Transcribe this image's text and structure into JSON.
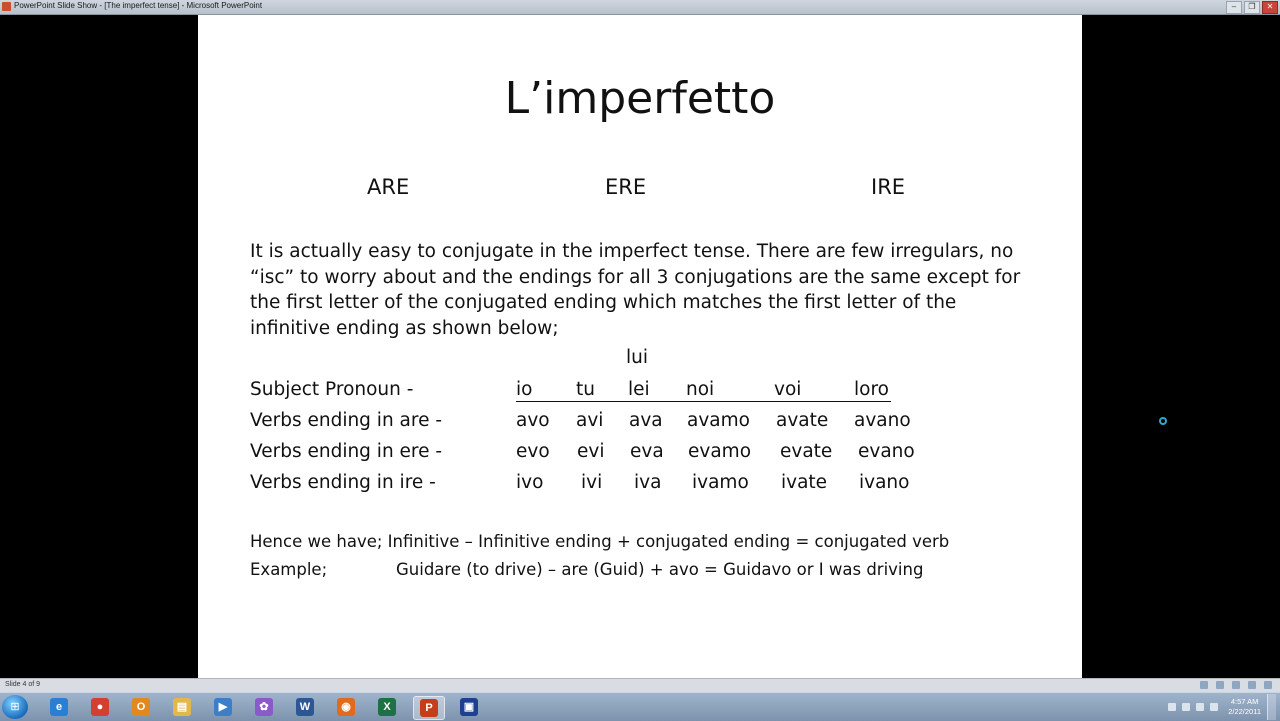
{
  "window": {
    "title": "PowerPoint Slide Show - [The imperfect tense] - Microsoft PowerPoint",
    "minimize_glyph": "–",
    "restore_glyph": "❐",
    "close_glyph": "✕"
  },
  "slide": {
    "title": "L’imperfetto",
    "headings": [
      "ARE",
      "ERE",
      "IRE"
    ],
    "paragraph": "It is actually easy to conjugate in the imperfect tense. There are few irregulars, no “isc” to worry about and the endings for all 3 conjugations are the same except for the first letter of the conjugated ending which matches the first letter of the infinitive ending as shown below;",
    "pronoun_note": "lui",
    "pronoun_label": "Subject Pronoun -",
    "pronouns": [
      "io",
      "tu",
      "lei",
      "noi",
      "voi",
      "loro"
    ],
    "rows": [
      {
        "label": "Verbs ending in are -",
        "endings": [
          "avo",
          "avi",
          "ava",
          "avamo",
          "avate",
          "avano"
        ]
      },
      {
        "label": "Verbs ending in ere -",
        "endings": [
          "evo",
          "evi",
          "eva",
          "evamo",
          "evate",
          "evano"
        ]
      },
      {
        "label": "Verbs ending in ire -",
        "endings": [
          "ivo",
          "ivi",
          "iva",
          "ivamo",
          "ivate",
          "ivano"
        ]
      }
    ],
    "formula": "Hence we have; Infinitive – Infinitive ending + conjugated ending = conjugated verb",
    "example_label": "Example;",
    "example_text": "Guidare (to drive) – are (Guid) + avo = Guidavo or I was driving"
  },
  "status": {
    "slide_indicator": "Slide 4 of 9"
  },
  "taskbar": {
    "start_glyph": "⊞",
    "apps": [
      {
        "name": "internet-explorer",
        "glyph": "e",
        "color": "#2a7fd4"
      },
      {
        "name": "chrome",
        "glyph": "●",
        "color": "#d4402f"
      },
      {
        "name": "outlook",
        "glyph": "O",
        "color": "#e08a1e"
      },
      {
        "name": "explorer",
        "glyph": "▤",
        "color": "#e2b84a"
      },
      {
        "name": "media-player",
        "glyph": "▶",
        "color": "#3a7fc8"
      },
      {
        "name": "picasa",
        "glyph": "✿",
        "color": "#8a5bc8"
      },
      {
        "name": "word",
        "glyph": "W",
        "color": "#2b5797"
      },
      {
        "name": "firefox",
        "glyph": "◉",
        "color": "#e06b1f"
      },
      {
        "name": "excel",
        "glyph": "X",
        "color": "#1e7145"
      },
      {
        "name": "powerpoint",
        "glyph": "P",
        "color": "#c43e1c"
      },
      {
        "name": "app-window",
        "glyph": "▣",
        "color": "#1f3f8f"
      }
    ],
    "clock_time": "4:57 AM",
    "clock_date": "2/22/2011"
  }
}
